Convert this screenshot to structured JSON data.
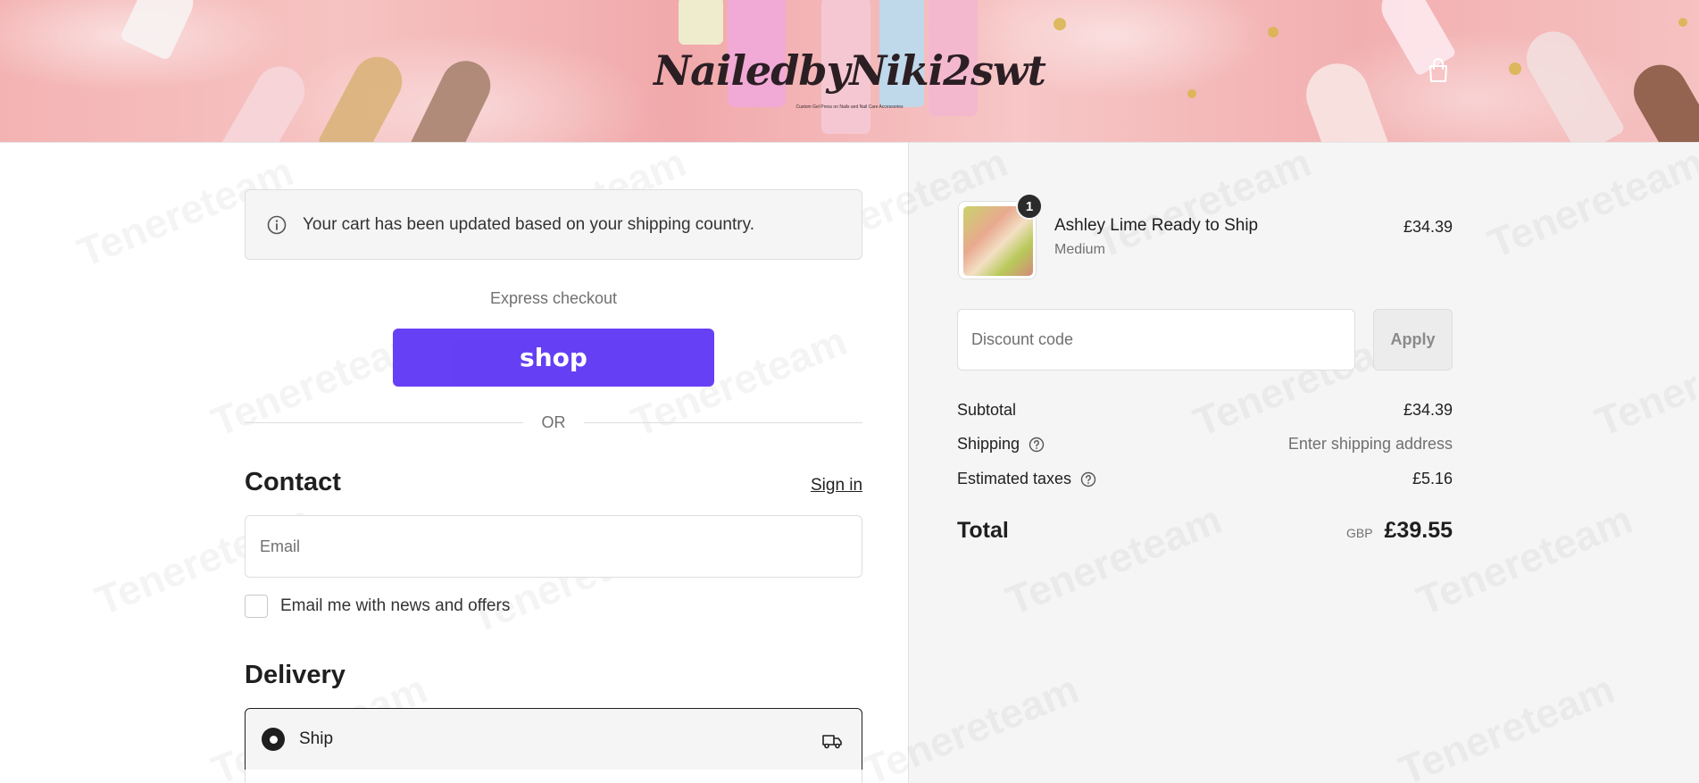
{
  "header": {
    "logo_text": "NailedbyNiki2swt",
    "logo_tagline": "Custom Gel Press on Nails and Nail Care Accessories",
    "cart_icon": "shopping-bag-icon"
  },
  "notice": {
    "icon": "info-icon",
    "text": "Your cart has been updated based on your shipping country."
  },
  "express": {
    "label": "Express checkout",
    "shop_button": "shop",
    "or_divider": "OR"
  },
  "contact": {
    "title": "Contact",
    "sign_in": "Sign in",
    "email_placeholder": "Email",
    "newsletter_label": "Email me with news and offers",
    "newsletter_checked": false
  },
  "delivery": {
    "title": "Delivery",
    "options": [
      {
        "label": "Ship",
        "selected": true,
        "icon": "truck-icon"
      }
    ]
  },
  "order": {
    "item": {
      "quantity": "1",
      "name": "Ashley Lime Ready to Ship",
      "variant": "Medium",
      "price": "£34.39"
    },
    "discount_placeholder": "Discount code",
    "apply_label": "Apply",
    "subtotal_label": "Subtotal",
    "subtotal_value": "£34.39",
    "shipping_label": "Shipping",
    "shipping_value": "Enter shipping address",
    "taxes_label": "Estimated taxes",
    "taxes_value": "£5.16",
    "total_label": "Total",
    "total_currency": "GBP",
    "total_value": "£39.55"
  },
  "watermark": "Tenereteam",
  "colors": {
    "shop_purple": "#5a31f4",
    "panel_gray": "#f5f5f5",
    "text_dark": "#1f1f1f",
    "text_muted": "#707070"
  }
}
